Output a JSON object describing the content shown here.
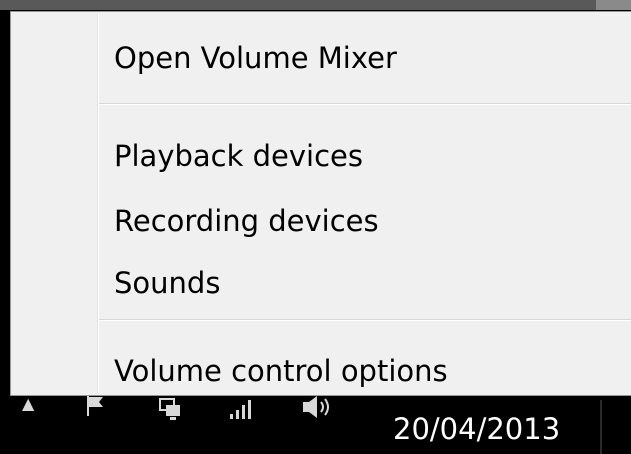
{
  "context_menu": {
    "items": [
      {
        "label": "Open Volume Mixer"
      },
      {
        "label": "Playback devices"
      },
      {
        "label": "Recording devices"
      },
      {
        "label": "Sounds"
      },
      {
        "label": "Volume control options"
      }
    ]
  },
  "taskbar": {
    "date": "20/04/2013",
    "tray_icons": [
      "show-hidden-icons-arrow-icon",
      "action-center-flag-icon",
      "network-icon",
      "signal-bars-icon",
      "speaker-volume-icon"
    ]
  }
}
